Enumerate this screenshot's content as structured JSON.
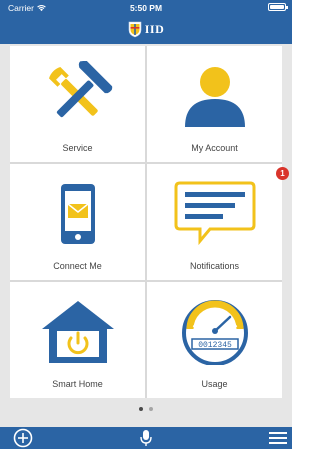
{
  "status_bar": {
    "carrier": "Carrier",
    "time": "5:50 PM"
  },
  "header": {
    "logo_text": "IID"
  },
  "tiles": [
    {
      "label": "Service",
      "icon": "tools-icon"
    },
    {
      "label": "My Account",
      "icon": "user-icon"
    },
    {
      "label": "Connect Me",
      "icon": "phone-mail-icon"
    },
    {
      "label": "Notifications",
      "icon": "message-icon",
      "badge": "1"
    },
    {
      "label": "Smart Home",
      "icon": "smart-home-icon"
    },
    {
      "label": "Usage",
      "icon": "meter-icon",
      "meter_reading": "0012345"
    }
  ],
  "pagination": {
    "pages": 2,
    "current": 1
  },
  "bottom_bar": {
    "left": "add-icon",
    "center": "microphone-icon",
    "right": "menu-icon"
  },
  "colors": {
    "primary": "#2b64a4",
    "accent": "#f2c21b",
    "badge": "#d9342b",
    "background": "#e6e6e6"
  }
}
